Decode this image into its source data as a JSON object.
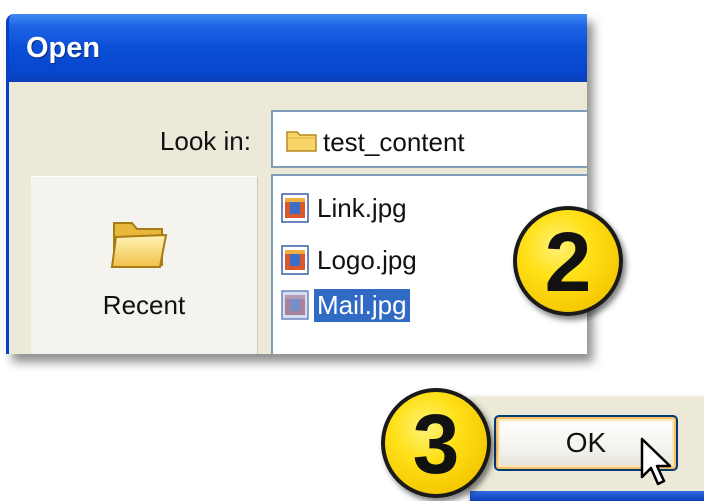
{
  "dialog": {
    "title": "Open",
    "look_in_label": "Look in:",
    "look_in_value": "test_content",
    "places": [
      {
        "label": "Recent",
        "icon": "folder-icon"
      }
    ],
    "files": [
      {
        "name": "Link.jpg",
        "icon": "jpg-image-icon",
        "selected": false
      },
      {
        "name": "Logo.jpg",
        "icon": "jpg-image-icon",
        "selected": false
      },
      {
        "name": "Mail.jpg",
        "icon": "jpg-image-icon",
        "selected": true
      }
    ]
  },
  "steps": {
    "step2": "2",
    "step3": "3"
  },
  "buttons": {
    "ok_label": "OK"
  },
  "colors": {
    "titlebar": "#0a4fd8",
    "dialog_bg": "#ece9d8",
    "selection": "#316ac5",
    "badge": "#ffe11a"
  },
  "icons": {
    "cursor": "mouse-pointer-icon"
  }
}
